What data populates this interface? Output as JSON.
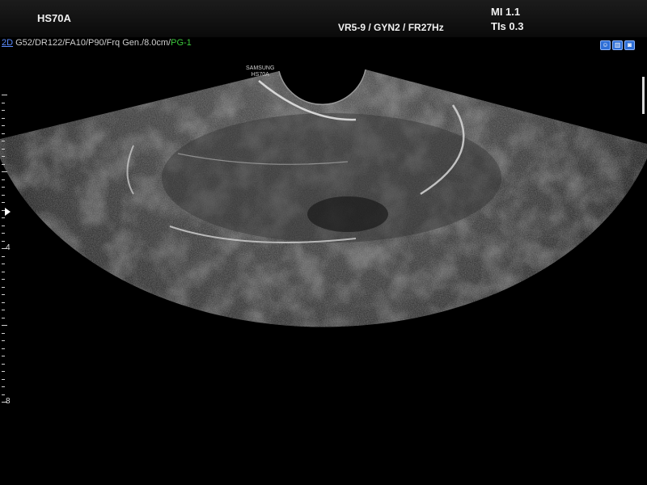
{
  "header": {
    "model": "HS70A",
    "probe_info": "VR5-9 / GYN2 / FR27Hz",
    "mi": "MI  1.1",
    "tis": "TIs 0.3"
  },
  "params": {
    "mode": "2D",
    "settings": " G52/DR122/FA10/P90/Frq Gen./8.0cm/",
    "preset": "PG-1"
  },
  "brand": {
    "line1": "SAMSUNG",
    "line2": "HS70A"
  },
  "tools": [
    "patient-icon",
    "compare-icon",
    "probe-icon"
  ],
  "depth_scale": {
    "label_4": "4",
    "label_8": "8"
  }
}
